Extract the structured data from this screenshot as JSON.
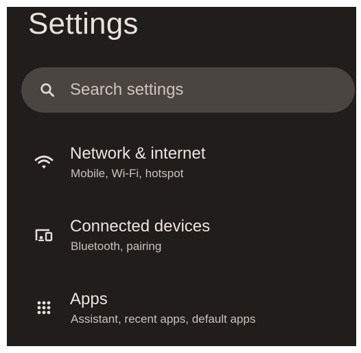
{
  "header": {
    "title": "Settings"
  },
  "search": {
    "icon": "search-icon",
    "placeholder": "Search settings"
  },
  "settings_items": [
    {
      "icon": "wifi-icon",
      "title": "Network & internet",
      "subtitle": "Mobile, Wi-Fi, hotspot"
    },
    {
      "icon": "connected-devices-icon",
      "title": "Connected devices",
      "subtitle": "Bluetooth, pairing"
    },
    {
      "icon": "apps-grid-icon",
      "title": "Apps",
      "subtitle": "Assistant, recent apps, default apps"
    }
  ],
  "colors": {
    "background": "#211d1b",
    "search_bar": "#4a4541",
    "primary_text": "#ece3de",
    "secondary_text": "#cbc2bc"
  }
}
